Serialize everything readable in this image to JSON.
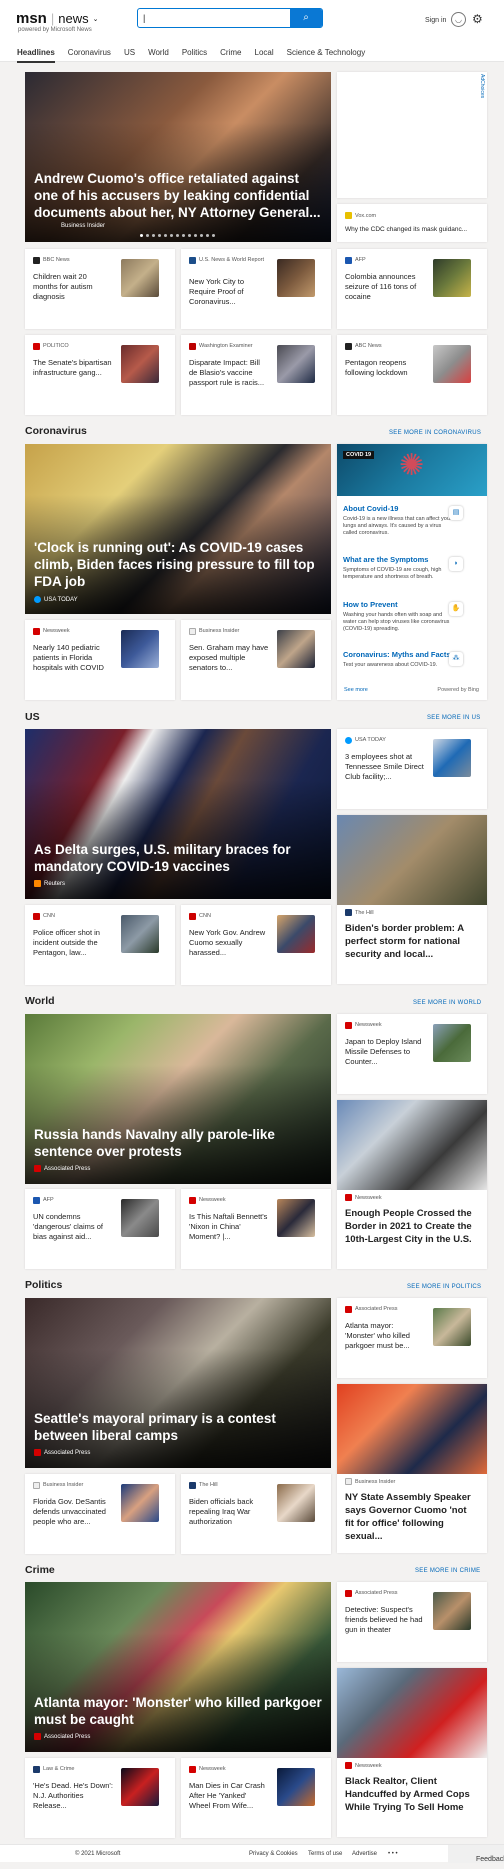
{
  "header": {
    "brand": "msn",
    "section": "news",
    "powered": "powered by Microsoft News",
    "search_value": "|",
    "signin": "Sign in"
  },
  "nav": [
    "Headlines",
    "Coronavirus",
    "US",
    "World",
    "Politics",
    "Crime",
    "Local",
    "Science & Technology"
  ],
  "top": {
    "hero": {
      "title": "Andrew Cuomo's office retaliated against one of his accusers by leaking confidential documents about her, NY Attorney General...",
      "source": "Business Insider"
    },
    "ad_label": "AdChoices",
    "side": {
      "source": "Vox.com",
      "title": "Why the CDC changed its mask guidanc..."
    },
    "cards": [
      {
        "source": "BBC News",
        "title": "Children wait 20 months for autism diagnosis"
      },
      {
        "source": "U.S. News & World Report",
        "title": "New York City to Require Proof of Coronavirus..."
      },
      {
        "source": "AFP",
        "title": "Colombia announces seizure of 116 tons of cocaine"
      },
      {
        "source": "POLITICO",
        "title": "The Senate's bipartisan infrastructure gang..."
      },
      {
        "source": "Washington Examiner",
        "title": "Disparate Impact: Bill de Blasio's vaccine passport rule is racis..."
      },
      {
        "source": "ABC News",
        "title": "Pentagon reopens following lockdown"
      }
    ]
  },
  "coronavirus": {
    "heading": "Coronavirus",
    "see_more": "SEE MORE IN CORONAVIRUS",
    "hero": {
      "title": "'Clock is running out': As COVID-19 cases climb, Biden faces rising pressure to fill top FDA job",
      "source": "USA TODAY"
    },
    "cards": [
      {
        "source": "Newsweek",
        "title": "Nearly 140 pediatric patients in Florida hospitals with COVID"
      },
      {
        "source": "Business Insider",
        "title": "Sen. Graham may have exposed multiple senators to..."
      }
    ],
    "panel": {
      "badge": "COVID 19",
      "items": [
        {
          "title": "About Covid-19",
          "text": "Covid-19 is a new illness that can affect your lungs and airways. It's caused by a virus called coronavirus."
        },
        {
          "title": "What are the Symptoms",
          "text": "Symptoms of COVID-19 are cough, high temperature and shortness of breath."
        },
        {
          "title": "How to Prevent",
          "text": "Washing your hands often with soap and water can help stop viruses like coronavirus (COVID-19) spreading."
        },
        {
          "title": "Coronavirus: Myths and Facts",
          "text": "Test your awareness about COVID-19."
        }
      ],
      "see_more": "See more",
      "powered": "Powered by Bing"
    }
  },
  "us": {
    "heading": "US",
    "see_more": "SEE MORE IN US",
    "hero": {
      "title": "As Delta surges, U.S. military braces for mandatory COVID-19 vaccines",
      "source": "Reuters"
    },
    "side": {
      "source": "USA TODAY",
      "title": "3 employees shot at Tennessee Smile Direct Club facility;..."
    },
    "tall": {
      "source": "The Hill",
      "title": "Biden's border problem: A perfect storm for national security and local..."
    },
    "cards": [
      {
        "source": "CNN",
        "title": "Police officer shot in incident outside the Pentagon, law..."
      },
      {
        "source": "CNN",
        "title": "New York Gov. Andrew Cuomo sexually harassed..."
      }
    ]
  },
  "world": {
    "heading": "World",
    "see_more": "SEE MORE IN WORLD",
    "hero": {
      "title": "Russia hands Navalny ally parole-like sentence over protests",
      "source": "Associated Press"
    },
    "side": {
      "source": "Newsweek",
      "title": "Japan to Deploy Island Missile Defenses to Counter..."
    },
    "tall": {
      "source": "Newsweek",
      "title": "Enough People Crossed the Border in 2021 to Create the 10th-Largest City in the U.S."
    },
    "cards": [
      {
        "source": "AFP",
        "title": "UN condemns 'dangerous' claims of bias against aid..."
      },
      {
        "source": "Newsweek",
        "title": "Is This Naftali Bennett's 'Nixon in China' Moment? |..."
      }
    ]
  },
  "politics": {
    "heading": "Politics",
    "see_more": "SEE MORE IN POLITICS",
    "hero": {
      "title": "Seattle's mayoral primary is a contest between liberal camps",
      "source": "Associated Press"
    },
    "side": {
      "source": "Associated Press",
      "title": "Atlanta mayor: 'Monster' who killed parkgoer must be..."
    },
    "tall": {
      "source": "Business Insider",
      "title": "NY State Assembly Speaker says Governor Cuomo 'not fit for office' following sexual..."
    },
    "cards": [
      {
        "source": "Business Insider",
        "title": "Florida Gov. DeSantis defends unvaccinated people who are..."
      },
      {
        "source": "The Hill",
        "title": "Biden officials back repealing Iraq War authorization"
      }
    ]
  },
  "crime": {
    "heading": "Crime",
    "see_more": "SEE MORE IN CRIME",
    "hero": {
      "title": "Atlanta mayor: 'Monster' who killed parkgoer must be caught",
      "source": "Associated Press"
    },
    "side": {
      "source": "Associated Press",
      "title": "Detective: Suspect's friends believed he had gun in theater"
    },
    "tall": {
      "source": "Newsweek",
      "title": "Black Realtor, Client Handcuffed by Armed Cops While Trying To Sell Home"
    },
    "cards": [
      {
        "source": "Law & Crime",
        "title": "'He's Dead. He's Down': N.J. Authorities Release..."
      },
      {
        "source": "Newsweek",
        "title": "Man Dies in Car Crash After He 'Yanked' Wheel From Wife..."
      }
    ]
  },
  "footer": {
    "copyright": "© 2021 Microsoft",
    "privacy": "Privacy & Cookies",
    "terms": "Terms of use",
    "advertise": "Advertise",
    "more": "• • •",
    "feedback": "Feedback"
  }
}
